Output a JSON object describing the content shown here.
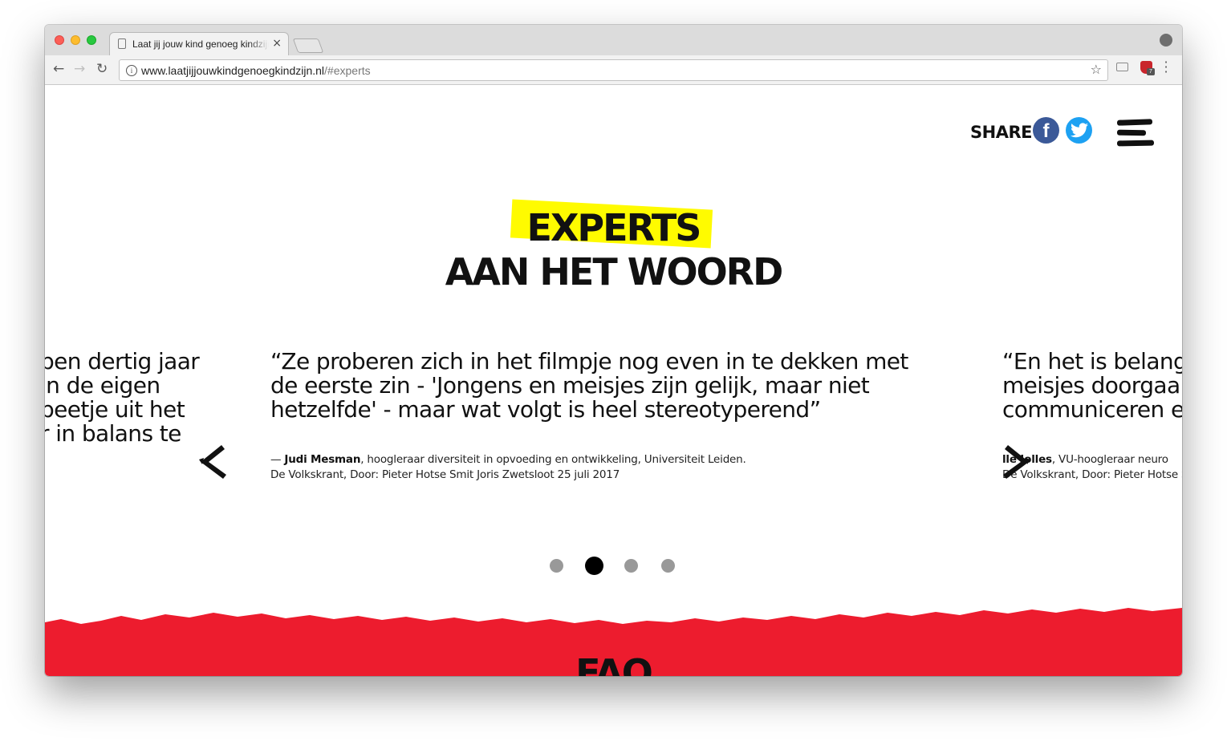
{
  "browser": {
    "tab_title": "Laat jij jouw kind genoeg kindzijn",
    "tab_close": "×",
    "url_host": "www.laatjijjouwkindgenoegkindzijn.nl",
    "url_path": "/#experts",
    "extension_badge": "7",
    "icons": [
      "back-icon",
      "forward-icon",
      "reload-icon",
      "info-icon",
      "star-icon",
      "camera-icon",
      "extension-icon",
      "menu-icon",
      "profile-icon"
    ]
  },
  "header": {
    "share_label": "SHARE",
    "facebook_glyph": "f"
  },
  "section": {
    "heading_line1": "EXPERTS",
    "heading_line2": "AAN HET WOORD",
    "highlight_color": "#fffb00"
  },
  "carousel": {
    "left_quote_lines": [
      "ben dertig jaar",
      "in de eigen",
      " beetje uit het",
      "r in balans te"
    ],
    "center_quote_lines": [
      "“Ze proberen zich in het filmpje nog even in te dekken met",
      "de eerste zin - 'Jongens en meisjes zijn gelijk, maar niet",
      "hetzelfde' - maar wat volgt is heel stereotyperend”"
    ],
    "center_dash": "— ",
    "center_author": "Judi Mesman",
    "center_author_role": ", hoogleraar diversiteit in opvoeding en ontwikkeling, Universiteit Leiden.",
    "center_source": "De Volkskrant, Door: Pieter Hotse Smit Joris Zwetsloot 25 juli 2017",
    "right_quote_lines": [
      "“En het is belang",
      "meisjes doorgaa",
      "communiceren e"
    ],
    "right_author": "lle Jolles",
    "right_author_role": ", VU-hoogleraar neuro",
    "right_source": "De Volkskrant, Door: Pieter Hotse Sm",
    "dots": 4,
    "active_dot": 2
  },
  "next_section": {
    "title": "FAQ",
    "color": "#ed1c2e"
  }
}
